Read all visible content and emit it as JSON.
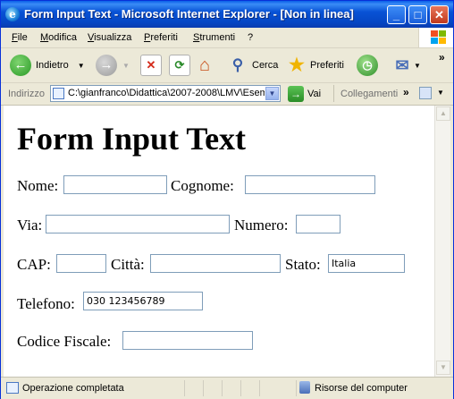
{
  "window": {
    "title": "Form Input Text - Microsoft Internet Explorer - [Non in linea]",
    "btn_min": "_",
    "btn_max": "□",
    "btn_close": "✕"
  },
  "menu": {
    "file": "File",
    "modifica": "Modifica",
    "visualizza": "Visualizza",
    "preferiti": "Preferiti",
    "strumenti": "Strumenti",
    "help": "?"
  },
  "toolbar": {
    "back": "Indietro",
    "search": "Cerca",
    "favorites": "Preferiti"
  },
  "address": {
    "label": "Indirizzo",
    "url": "C:\\gianfranco\\Didattica\\2007-2008\\LMV\\Esem",
    "go": "Vai",
    "links": "Collegamenti"
  },
  "page": {
    "heading": "Form Input Text",
    "nome_label": "Nome:",
    "nome_value": "",
    "cognome_label": "Cognome:",
    "cognome_value": "",
    "via_label": "Via:",
    "via_value": "",
    "numero_label": "Numero:",
    "numero_value": "",
    "cap_label": "CAP:",
    "cap_value": "",
    "citta_label": "Città:",
    "citta_value": "",
    "stato_label": "Stato:",
    "stato_value": "Italia",
    "telefono_label": "Telefono:",
    "telefono_value": "030 123456789",
    "codice_label": "Codice Fiscale:",
    "codice_value": ""
  },
  "status": {
    "text": "Operazione completata",
    "zone": "Risorse del computer"
  },
  "colors": {
    "titlebar": "#0853d6",
    "chrome": "#ece9d8",
    "input_border": "#7f9db9"
  }
}
